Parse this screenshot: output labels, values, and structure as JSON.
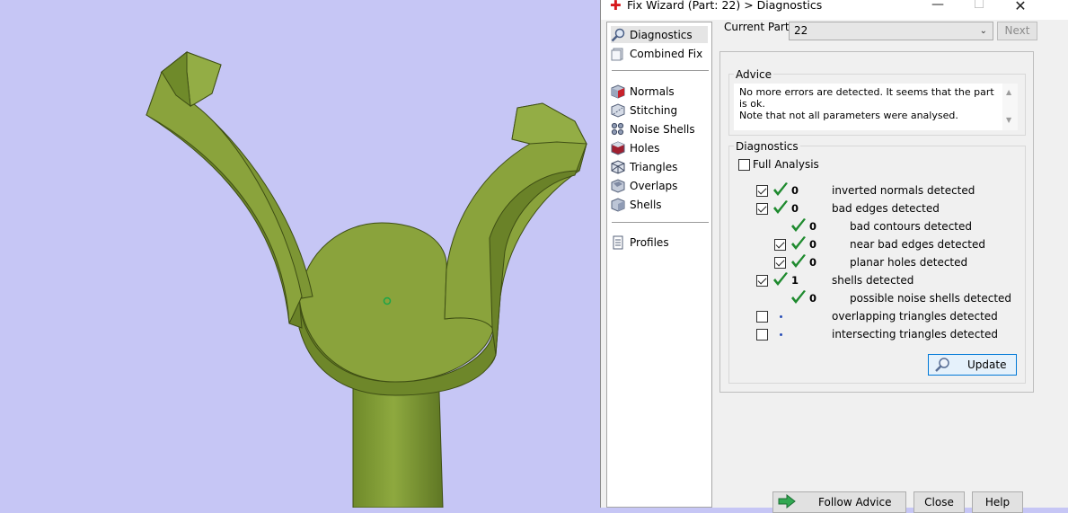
{
  "window": {
    "title": "Fix Wizard (Part: 22) > Diagnostics",
    "app_icon": "red-cross-icon",
    "controls": [
      "minimize-icon",
      "maximize-icon",
      "close-icon"
    ]
  },
  "nav": {
    "items": [
      {
        "label": "Diagnostics",
        "icon": "magnifier-icon",
        "selected": true
      },
      {
        "label": "Combined Fix",
        "icon": "combined-fix-icon"
      },
      {
        "label": "Normals",
        "icon": "normals-cube-icon"
      },
      {
        "label": "Stitching",
        "icon": "stitching-icon"
      },
      {
        "label": "Noise Shells",
        "icon": "noise-shells-icon"
      },
      {
        "label": "Holes",
        "icon": "holes-cube-icon"
      },
      {
        "label": "Triangles",
        "icon": "triangles-icon"
      },
      {
        "label": "Overlaps",
        "icon": "overlaps-icon"
      },
      {
        "label": "Shells",
        "icon": "shells-icon"
      },
      {
        "label": "Profiles",
        "icon": "profiles-icon"
      }
    ]
  },
  "current_part": {
    "label": "Current Part:",
    "value": "22",
    "next_label": "Next"
  },
  "advice": {
    "title": "Advice",
    "line1": "No more errors are detected. It seems that the part is ok.",
    "line2": "Note that not all parameters were analysed."
  },
  "diagnostics": {
    "title": "Diagnostics",
    "full_analysis": {
      "label": "Full Analysis",
      "checked": false
    },
    "rows": [
      {
        "checkbox": true,
        "checked": true,
        "status": "ok",
        "count": "0",
        "label": "inverted normals detected",
        "indent": 0
      },
      {
        "checkbox": true,
        "checked": true,
        "status": "ok",
        "count": "0",
        "label": "bad edges detected",
        "indent": 0
      },
      {
        "checkbox": false,
        "checked": false,
        "status": "ok",
        "count": "0",
        "label": "bad contours detected",
        "indent": 1
      },
      {
        "checkbox": true,
        "checked": true,
        "status": "ok",
        "count": "0",
        "label": "near bad edges detected",
        "indent": 1
      },
      {
        "checkbox": true,
        "checked": true,
        "status": "ok",
        "count": "0",
        "label": "planar holes detected",
        "indent": 1
      },
      {
        "checkbox": true,
        "checked": true,
        "status": "ok",
        "count": "1",
        "label": "shells detected",
        "indent": 0
      },
      {
        "checkbox": false,
        "checked": false,
        "status": "ok",
        "count": "0",
        "label": "possible noise shells detected",
        "indent": 1
      },
      {
        "checkbox": true,
        "checked": false,
        "status": "pending",
        "count": "",
        "label": "overlapping triangles detected",
        "indent": 0
      },
      {
        "checkbox": true,
        "checked": false,
        "status": "pending",
        "count": "",
        "label": "intersecting triangles detected",
        "indent": 0
      }
    ],
    "update_label": "Update"
  },
  "buttons": {
    "follow_advice": "Follow Advice",
    "close": "Close",
    "help": "Help"
  },
  "colors": {
    "viewport_bg": "#c6c6f5",
    "part_face": "#8aa33c",
    "part_side": "#6c8428",
    "check_green": "#1e8a2e",
    "title_icon_red": "#d7191c"
  }
}
